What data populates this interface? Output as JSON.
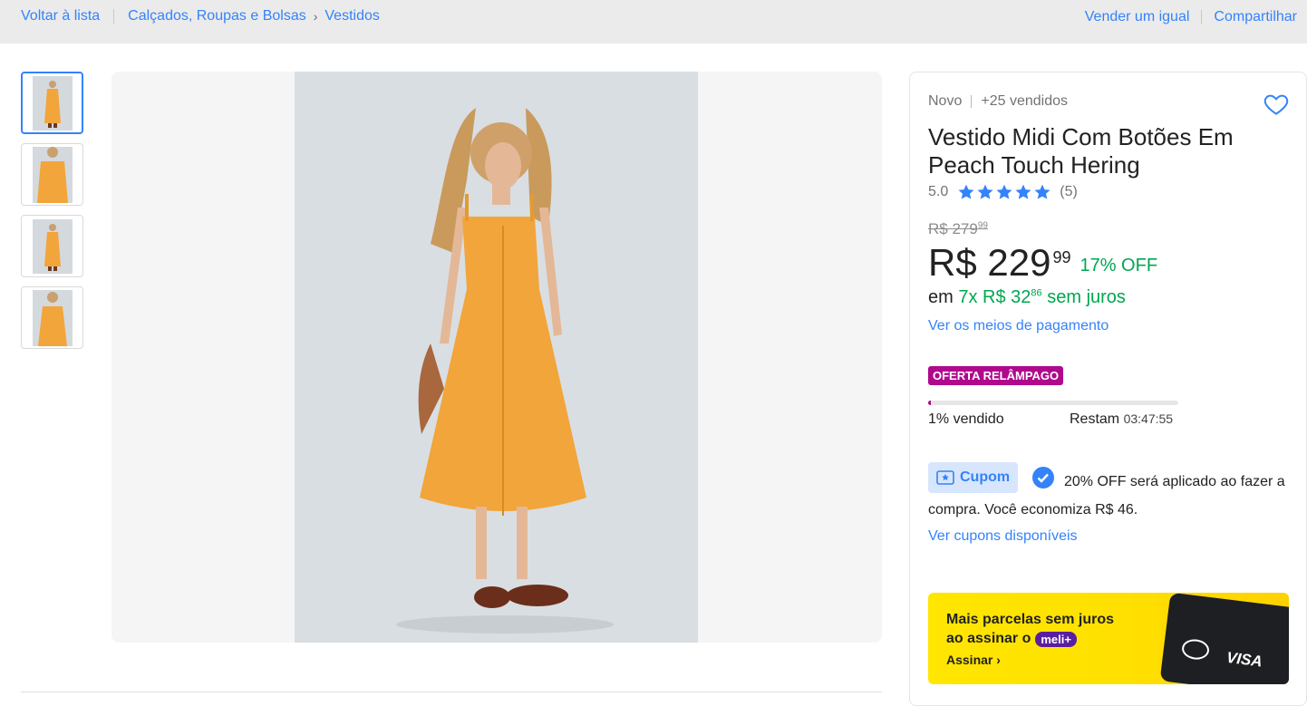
{
  "breadcrumb": {
    "back": "Voltar à lista",
    "category": "Calçados, Roupas e Bolsas",
    "subcategory": "Vestidos"
  },
  "actions": {
    "sell": "Vender um igual",
    "share": "Compartilhar"
  },
  "product": {
    "condition": "Novo",
    "sold": "+25 vendidos",
    "title": "Vestido Midi Com Botões Em Peach Touch Hering",
    "rating": "5.0",
    "stars": 5,
    "reviews": "(5)",
    "old_price": "R$ 279",
    "old_cents": "99",
    "price": "R$ 229",
    "price_cents": "99",
    "discount": "17% OFF",
    "installment_prefix": "em",
    "installment": "7x R$ 32",
    "installment_cents": "86",
    "installment_suffix": "sem juros",
    "payment_link": "Ver os meios de pagamento"
  },
  "flash": {
    "badge": "OFERTA RELÂMPAGO",
    "sold_label": "1% vendido",
    "progress": 0.01,
    "remain_label": "Restam",
    "time": "03:47:55"
  },
  "coupon": {
    "label": "Cupom",
    "text": "20% OFF será aplicado ao fazer a compra. Você economiza R$ 46.",
    "link": "Ver cupons disponíveis"
  },
  "promo": {
    "line1": "Mais parcelas sem juros",
    "line2": "ao assinar o",
    "brand": "meli+",
    "cta": "Assinar",
    "card_brand": "VISA"
  },
  "colors": {
    "accent": "#3483fa",
    "green": "#00a650",
    "flash": "#b0098c"
  }
}
